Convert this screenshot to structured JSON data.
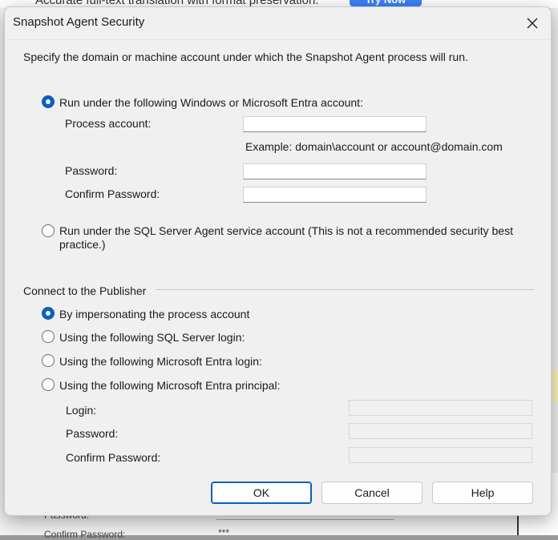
{
  "background": {
    "top_text": "Accurate full-text translation with format preservation.",
    "top_button": "Try Now",
    "bottom_label_password": "Password:",
    "bottom_label_confirm": "Confirm Password:",
    "bottom_value": "***"
  },
  "dialog": {
    "title": "Snapshot Agent Security",
    "description": "Specify the domain or machine account under which the Snapshot Agent process will run.",
    "option_windows_account": "Run under the following Windows or Microsoft Entra account:",
    "process_account_label": "Process account:",
    "process_account_value": "",
    "example_text": "Example: domain\\account or account@domain.com",
    "password_label": "Password:",
    "password_value": "",
    "confirm_password_label": "Confirm Password:",
    "confirm_password_value": "",
    "option_sql_agent": "Run under the SQL Server Agent service account (This is not a recommended security best practice.)",
    "publisher_group_label": "Connect to the Publisher",
    "publisher_options": [
      "By impersonating the process account",
      "Using the following SQL Server login:",
      "Using the following Microsoft Entra login:",
      "Using the following Microsoft Entra principal:"
    ],
    "login_label": "Login:",
    "pub_password_label": "Password:",
    "pub_confirm_password_label": "Confirm Password:",
    "buttons": {
      "ok": "OK",
      "cancel": "Cancel",
      "help": "Help"
    }
  },
  "colors": {
    "accent": "#0a5fc2",
    "dialog_bg": "#f0f0f0"
  },
  "icons": {
    "close": "close-icon"
  }
}
